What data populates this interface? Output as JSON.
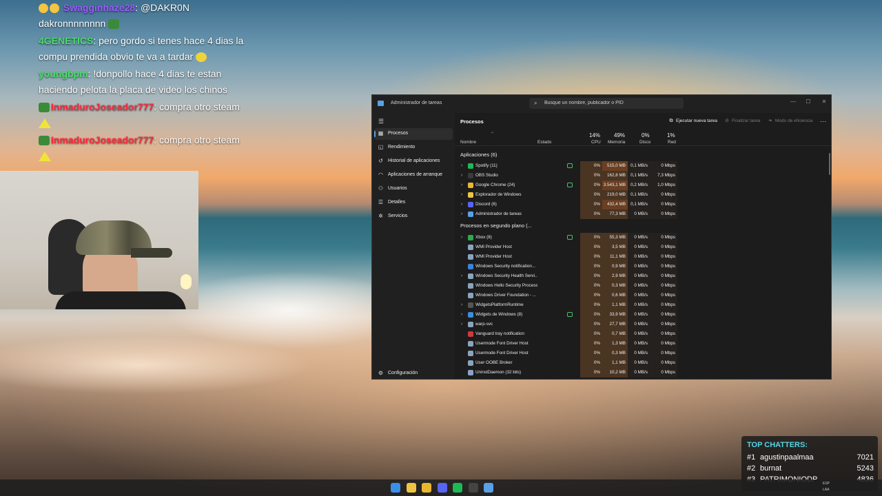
{
  "chat": [
    {
      "user": "Swagginhaze28",
      "mention": "@DAKR0N",
      "text": "dakronnnnnnnn"
    },
    {
      "user": "4GENETICS",
      "text": "pero gordo si tenes hace 4 dias la compu prendida obvio te va a tardar"
    },
    {
      "user": "youngbpm",
      "text": "!donpollo hace 4 dias te estan haciendo pelota la placa de video los chinos"
    },
    {
      "user": "InmaduroJoseador777",
      "text": "compra otro steam"
    },
    {
      "user": "InmaduroJoseador777",
      "text": "compra otro steam"
    }
  ],
  "taskmgr": {
    "title": "Administrador de tareas",
    "search_placeholder": "Busque un nombre, publicador o PID",
    "nav": [
      {
        "label": "Procesos",
        "icon": "grid-icon"
      },
      {
        "label": "Rendimiento",
        "icon": "chart-icon"
      },
      {
        "label": "Historial de aplicaciones",
        "icon": "history-icon"
      },
      {
        "label": "Aplicaciones de arranque",
        "icon": "gauge-icon"
      },
      {
        "label": "Usuarios",
        "icon": "users-icon"
      },
      {
        "label": "Detalles",
        "icon": "list-icon"
      },
      {
        "label": "Servicios",
        "icon": "services-icon"
      }
    ],
    "settings_label": "Configuración",
    "heading": "Procesos",
    "toolbar": {
      "run_task": "Ejecutar nueva tarea",
      "end_task": "Finalizar tarea",
      "efficiency": "Modo de eficiencia",
      "more": "⋯"
    },
    "columns": {
      "name": "Nombre",
      "status": "Estado",
      "cpu_label": "CPU",
      "cpu_pct": "14%",
      "mem_label": "Memoria",
      "mem_pct": "49%",
      "disk_label": "Disco",
      "disk_pct": "0%",
      "net_label": "Red",
      "net_pct": "1%"
    },
    "apps_group": "Aplicaciones (6)",
    "apps": [
      {
        "name": "Spotify (11)",
        "cpu": "0%",
        "mem": "515,0 MB",
        "disk": "0,1 MB/s",
        "net": "0 Mbps",
        "exp": true,
        "eff": true,
        "color": "#1db954",
        "hi": true
      },
      {
        "name": "OBS Studio",
        "cpu": "0%",
        "mem": "162,8 MB",
        "disk": "0,1 MB/s",
        "net": "7,3 Mbps",
        "exp": true,
        "eff": false,
        "color": "#3a3a3a",
        "hi": false
      },
      {
        "name": "Google Chrome (24)",
        "cpu": "0%",
        "mem": "3.543,1 MB",
        "disk": "0,2 MB/s",
        "net": "1,0 Mbps",
        "exp": true,
        "eff": true,
        "color": "#e8b730",
        "hi": true
      },
      {
        "name": "Explorador de Windows",
        "cpu": "0%",
        "mem": "219,0 MB",
        "disk": "0,1 MB/s",
        "net": "0 Mbps",
        "exp": true,
        "eff": false,
        "color": "#f0c443",
        "hi": false
      },
      {
        "name": "Discord (6)",
        "cpu": "0%",
        "mem": "432,4 MB",
        "disk": "0,1 MB/s",
        "net": "0 Mbps",
        "exp": true,
        "eff": false,
        "color": "#5865f2",
        "hi": true
      },
      {
        "name": "Administrador de tareas",
        "cpu": "0%",
        "mem": "77,3 MB",
        "disk": "0 MB/s",
        "net": "0 Mbps",
        "exp": true,
        "eff": false,
        "color": "#5aa0e6",
        "hi": false
      }
    ],
    "bg_group": "Procesos en segundo plano (...",
    "background": [
      {
        "name": "Xbox (8)",
        "cpu": "0%",
        "mem": "55,3 MB",
        "disk": "0 MB/s",
        "net": "0 Mbps",
        "exp": true,
        "eff": true,
        "color": "#2fa84f"
      },
      {
        "name": "WMI Provider Host",
        "cpu": "0%",
        "mem": "3,5 MB",
        "disk": "0 MB/s",
        "net": "0 Mbps",
        "exp": false,
        "eff": false,
        "color": "#8aa4c0"
      },
      {
        "name": "WMI Provider Host",
        "cpu": "0%",
        "mem": "11,1 MB",
        "disk": "0 MB/s",
        "net": "0 Mbps",
        "exp": false,
        "eff": false,
        "color": "#8aa4c0"
      },
      {
        "name": "Windows Security notification...",
        "cpu": "0%",
        "mem": "0,9 MB",
        "disk": "0 MB/s",
        "net": "0 Mbps",
        "exp": false,
        "eff": false,
        "color": "#3b82d6"
      },
      {
        "name": "Windows Security Health Servi...",
        "cpu": "0%",
        "mem": "2,9 MB",
        "disk": "0 MB/s",
        "net": "0 Mbps",
        "exp": true,
        "eff": false,
        "color": "#8aa4c0"
      },
      {
        "name": "Windows Hello Security Process",
        "cpu": "0%",
        "mem": "0,3 MB",
        "disk": "0 MB/s",
        "net": "0 Mbps",
        "exp": false,
        "eff": false,
        "color": "#8aa4c0"
      },
      {
        "name": "Windows Driver Foundation - ...",
        "cpu": "0%",
        "mem": "0,6 MB",
        "disk": "0 MB/s",
        "net": "0 Mbps",
        "exp": false,
        "eff": false,
        "color": "#8aa4c0"
      },
      {
        "name": "WidgetsPlatformRuntime",
        "cpu": "0%",
        "mem": "1,1 MB",
        "disk": "0 MB/s",
        "net": "0 Mbps",
        "exp": true,
        "eff": false,
        "color": "#555"
      },
      {
        "name": "Widgets de Windows (8)",
        "cpu": "0%",
        "mem": "33,9 MB",
        "disk": "0 MB/s",
        "net": "0 Mbps",
        "exp": true,
        "eff": true,
        "color": "#3a8fd9"
      },
      {
        "name": "warp-svc",
        "cpu": "0%",
        "mem": "27,7 MB",
        "disk": "0 MB/s",
        "net": "0 Mbps",
        "exp": true,
        "eff": false,
        "color": "#8aa4c0"
      },
      {
        "name": "Vanguard tray notification",
        "cpu": "0%",
        "mem": "0,7 MB",
        "disk": "0 MB/s",
        "net": "0 Mbps",
        "exp": false,
        "eff": false,
        "color": "#d03a3a"
      },
      {
        "name": "Usermode Font Driver Host",
        "cpu": "0%",
        "mem": "1,3 MB",
        "disk": "0 MB/s",
        "net": "0 Mbps",
        "exp": false,
        "eff": false,
        "color": "#8aa4c0"
      },
      {
        "name": "Usermode Font Driver Host",
        "cpu": "0%",
        "mem": "0,3 MB",
        "disk": "0 MB/s",
        "net": "0 Mbps",
        "exp": false,
        "eff": false,
        "color": "#8aa4c0"
      },
      {
        "name": "User OOBE Broker",
        "cpu": "0%",
        "mem": "1,1 MB",
        "disk": "0 MB/s",
        "net": "0 Mbps",
        "exp": false,
        "eff": false,
        "color": "#8aa4c0"
      },
      {
        "name": "UninstDaemon (32 bits)",
        "cpu": "0%",
        "mem": "10,2 MB",
        "disk": "0 MB/s",
        "net": "0 Mbps",
        "exp": false,
        "eff": false,
        "color": "#8aa4c0"
      }
    ]
  },
  "top_chatters": {
    "title": "TOP CHATTERS:",
    "entries": [
      {
        "rank": "#1",
        "name": "agustinpaalmaa",
        "score": "7021"
      },
      {
        "rank": "#2",
        "name": "burnat",
        "score": "5243"
      },
      {
        "rank": "#3",
        "name": "PATRIMONIODP",
        "score": "4836"
      }
    ]
  },
  "taskbar": {
    "icons": [
      {
        "name": "windows-start-icon",
        "color": "#3a8fe6"
      },
      {
        "name": "file-explorer-icon",
        "color": "#f0c443"
      },
      {
        "name": "chrome-icon",
        "color": "#e8b730"
      },
      {
        "name": "discord-icon",
        "color": "#5865f2"
      },
      {
        "name": "spotify-icon",
        "color": "#1db954"
      },
      {
        "name": "obs-icon",
        "color": "#444444"
      },
      {
        "name": "task-manager-icon",
        "color": "#5aa0e6"
      }
    ],
    "lang_top": "ESP",
    "lang_bottom": "LAA"
  }
}
